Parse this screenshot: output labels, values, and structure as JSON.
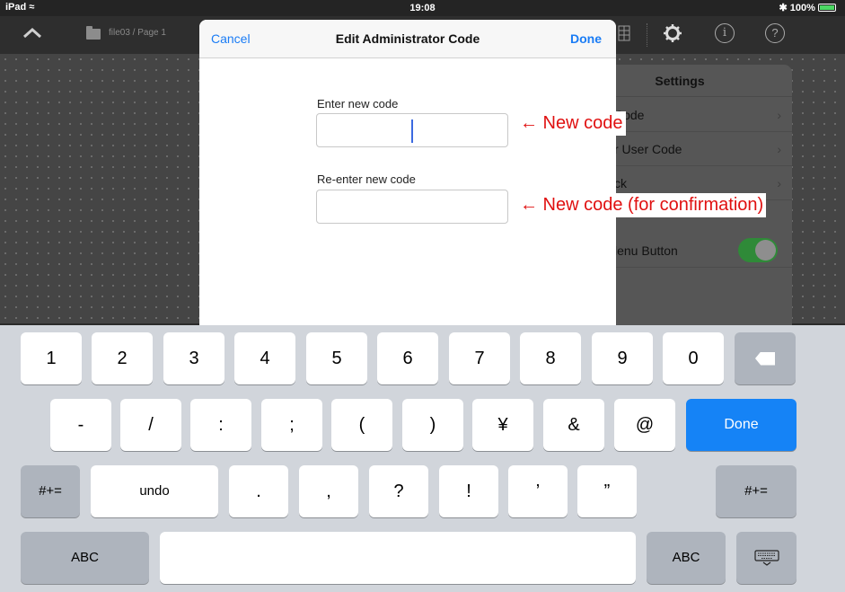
{
  "status_bar": {
    "device": "iPad",
    "time": "19:08",
    "battery": "100%"
  },
  "toolbar": {
    "file_path": "file03 / Page 1"
  },
  "settings_popover": {
    "title": "Settings",
    "rows": [
      {
        "label": "Code",
        "chevron": "›"
      },
      {
        "label": "r User Code",
        "chevron": "›"
      },
      {
        "label": "ck",
        "chevron": "›"
      },
      {
        "label": "lenu Button",
        "toggle_on": true
      }
    ]
  },
  "modal": {
    "cancel_label": "Cancel",
    "title": "Edit Administrator Code",
    "done_label": "Done",
    "field1_label": "Enter new code",
    "field2_label": "Re-enter new code"
  },
  "annotations": {
    "new_code": "← New code",
    "confirm_code": "← New code (for confirmation)"
  },
  "keyboard": {
    "row1": [
      "1",
      "2",
      "3",
      "4",
      "5",
      "6",
      "7",
      "8",
      "9",
      "0"
    ],
    "row2": [
      "-",
      "/",
      ":",
      ";",
      "(",
      ")",
      "¥",
      "&",
      "@"
    ],
    "done": "Done",
    "symbols_toggle": "#+=",
    "undo": "undo",
    "row3": [
      ".",
      ",",
      "?",
      "!",
      "’",
      "”"
    ],
    "abc": "ABC",
    "icons": {
      "delete": "backspace-icon",
      "dismiss": "keyboard-dismiss-icon"
    },
    "accent_color": "#1583f6"
  }
}
